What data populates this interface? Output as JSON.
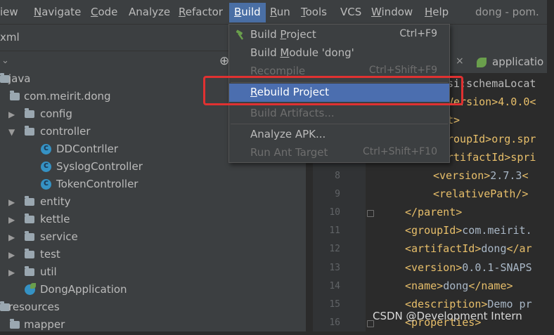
{
  "menubar": {
    "items": [
      {
        "label": "View",
        "mnemonic": "V",
        "rest": "iew"
      },
      {
        "label": "Navigate",
        "mnemonic": "N",
        "rest": "avigate"
      },
      {
        "label": "Code",
        "mnemonic": "C",
        "rest": "ode"
      },
      {
        "label": "Analyze",
        "mnemonic": "",
        "rest": "Analyze"
      },
      {
        "label": "Refactor",
        "mnemonic": "R",
        "rest": "efactor"
      },
      {
        "label": "Build",
        "mnemonic": "B",
        "rest": "uild"
      },
      {
        "label": "Run",
        "mnemonic": "R",
        "rest": "un"
      },
      {
        "label": "Tools",
        "mnemonic": "T",
        "rest": "ools"
      },
      {
        "label": "VCS",
        "mnemonic": "",
        "rest": "VCS"
      },
      {
        "label": "Window",
        "mnemonic": "W",
        "rest": "indow"
      },
      {
        "label": "Help",
        "mnemonic": "H",
        "rest": "elp"
      }
    ],
    "window_title": "dong - pom."
  },
  "breadcrumb": "xml",
  "project_tree": [
    {
      "label": "java",
      "kind": "folder-root"
    },
    {
      "label": "com.meirit.dong",
      "kind": "package"
    },
    {
      "label": "config",
      "kind": "package-collapsed"
    },
    {
      "label": "controller",
      "kind": "package-expanded"
    },
    {
      "label": "DDContrller",
      "kind": "class"
    },
    {
      "label": "SyslogController",
      "kind": "class"
    },
    {
      "label": "TokenController",
      "kind": "class"
    },
    {
      "label": "entity",
      "kind": "package-collapsed"
    },
    {
      "label": "kettle",
      "kind": "package-collapsed"
    },
    {
      "label": "service",
      "kind": "package-collapsed"
    },
    {
      "label": "test",
      "kind": "package-collapsed"
    },
    {
      "label": "util",
      "kind": "package-collapsed"
    },
    {
      "label": "DongApplication",
      "kind": "app-class"
    },
    {
      "label": "resources",
      "kind": "folder-root"
    },
    {
      "label": "mapper",
      "kind": "folder"
    }
  ],
  "editor": {
    "tab_label": "applicatio",
    "line_numbers": [
      "8",
      "9",
      "10",
      "11",
      "12",
      "13",
      "14",
      "15",
      "16"
    ],
    "partial_lines": [
      "si:schemaLocat",
      "Version>4.0.0<",
      "t>",
      "roupId>org.spr",
      "rtifactId>spri"
    ],
    "lines": [
      {
        "open": "<version>",
        "text": "2.7.3",
        "close": "<"
      },
      {
        "open": "<relativePath/>",
        "text": "",
        "close": ""
      },
      {
        "open": "</parent>",
        "text": "",
        "close": ""
      },
      {
        "open": "<groupId>",
        "text": "com.meirit.",
        "close": ""
      },
      {
        "open": "<artifactId>",
        "text": "dong",
        "close": "</ar"
      },
      {
        "open": "<version>",
        "text": "0.0.1-SNAPS",
        "close": ""
      },
      {
        "open": "<name>",
        "text": "dong",
        "close": "</name>"
      },
      {
        "open": "<description>",
        "text": "Demo pr",
        "close": ""
      },
      {
        "open": "<properties>",
        "text": "",
        "close": ""
      }
    ]
  },
  "build_menu": {
    "items": [
      {
        "label": "Build Project",
        "mnemonic_pre": "Build ",
        "mnemonic": "P",
        "mnemonic_post": "roject",
        "shortcut": "Ctrl+F9",
        "enabled": true,
        "icon": "hammer-icon"
      },
      {
        "label": "Build Module 'dong'",
        "mnemonic_pre": "Build ",
        "mnemonic": "M",
        "mnemonic_post": "odule 'dong'",
        "shortcut": "",
        "enabled": true
      },
      {
        "label": "Recompile",
        "shortcut": "Ctrl+Shift+F9",
        "enabled": false
      },
      {
        "label": "Rebuild Project",
        "mnemonic_pre": "",
        "mnemonic": "R",
        "mnemonic_post": "ebuild Project",
        "shortcut": "",
        "enabled": true,
        "selected": true
      },
      {
        "label": "Build Artifacts...",
        "shortcut": "",
        "enabled": false
      },
      {
        "label": "Analyze APK...",
        "shortcut": "",
        "enabled": true
      },
      {
        "label": "Run Ant Target",
        "shortcut": "Ctrl+Shift+F10",
        "enabled": false
      }
    ]
  },
  "colors": {
    "menu_highlight": "#4b6eaf",
    "annotation_box": "#e03131",
    "xml_tag": "#e8bf6a"
  },
  "watermark": "CSDN @Development Intern"
}
